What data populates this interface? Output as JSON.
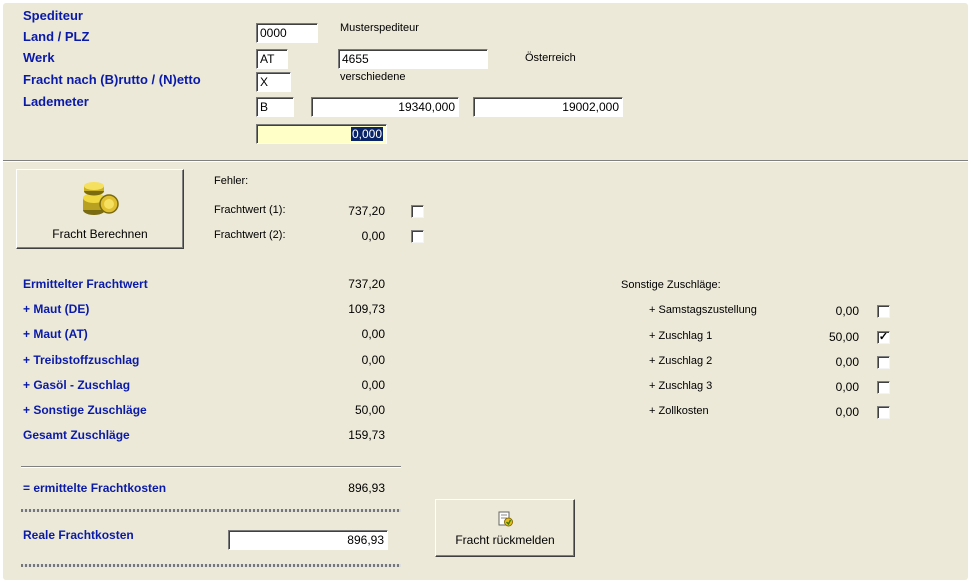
{
  "header": {
    "spediteur": {
      "label": "Spediteur",
      "code": "0000",
      "name": "Musterspediteur"
    },
    "land_plz": {
      "label": "Land / PLZ",
      "land": "AT",
      "plz": "4655",
      "country_name": "Österreich"
    },
    "werk": {
      "label": "Werk",
      "code": "X",
      "name": "verschiedene"
    },
    "fracht": {
      "label": "Fracht nach (B)rutto / (N)etto",
      "mode": "B",
      "brutto": "19340,000",
      "netto": "19002,000"
    },
    "lademeter": {
      "label": "Lademeter",
      "value": "0,000"
    }
  },
  "calc": {
    "button_label": "Fracht Berechnen",
    "button_icon": "coins-icon",
    "fehler_label": "Fehler:",
    "rows": [
      {
        "label": "Frachtwert (1):",
        "value": "737,20",
        "checked": false
      },
      {
        "label": "Frachtwert (2):",
        "value": "0,00",
        "checked": false
      }
    ]
  },
  "summary": {
    "rows": [
      {
        "label": "Ermittelter Frachtwert",
        "value": "737,20"
      },
      {
        "label": "+ Maut (DE)",
        "value": "109,73"
      },
      {
        "label": "+ Maut (AT)",
        "value": "0,00"
      },
      {
        "label": "+ Treibstoffzuschlag",
        "value": "0,00"
      },
      {
        "label": "+ Gasöl - Zuschlag",
        "value": "0,00"
      },
      {
        "label": "+ Sonstige Zuschläge",
        "value": "50,00"
      },
      {
        "label": "Gesamt Zuschläge",
        "value": "159,73"
      }
    ],
    "total_label": "= ermittelte Frachtkosten",
    "total_value": "896,93",
    "reale_label": "Reale Frachtkosten",
    "reale_value": "896,93"
  },
  "sonstige": {
    "title": "Sonstige Zuschläge:",
    "rows": [
      {
        "label": "+ Samstagszustellung",
        "value": "0,00",
        "checked": false
      },
      {
        "label": "+ Zuschlag 1",
        "value": "50,00",
        "checked": true
      },
      {
        "label": "+ Zuschlag 2",
        "value": "0,00",
        "checked": false
      },
      {
        "label": "+ Zuschlag 3",
        "value": "0,00",
        "checked": false
      },
      {
        "label": "+ Zollkosten",
        "value": "0,00",
        "checked": false
      }
    ]
  },
  "rueckmelden": {
    "button_label": "Fracht rückmelden",
    "button_icon": "report-icon"
  },
  "check_mark": "✓"
}
